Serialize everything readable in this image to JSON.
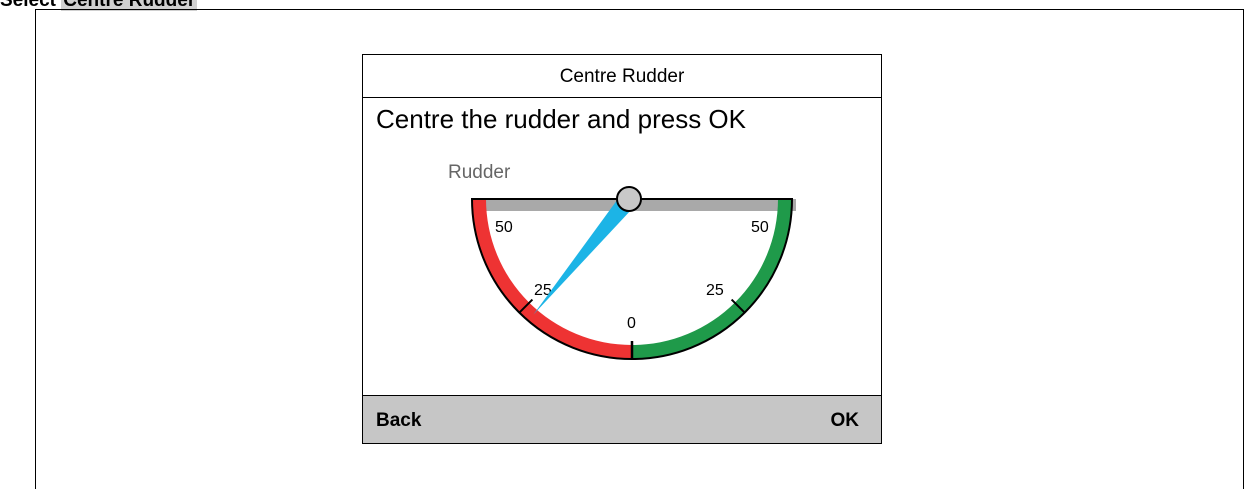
{
  "caption": {
    "prefix": "Select ",
    "highlight": "Centre Rudder"
  },
  "dialog": {
    "title": "Centre Rudder",
    "instruction": "Centre the rudder and press OK",
    "gauge": {
      "label": "Rudder",
      "tick_labels": {
        "port_50": "50",
        "port_25": "25",
        "zero": "0",
        "stbd_25": "25",
        "stbd_50": "50"
      },
      "rudder_angle": -22,
      "rudder_angle_note": "port side, degrees",
      "colors": {
        "port": "#ee3333",
        "starboard": "#1f9a4a",
        "needle": "#1cb4e6",
        "hub": "#c8c8c8",
        "bar": "#a9a9a9"
      }
    },
    "footer": {
      "back_label": "Back",
      "ok_label": "OK"
    }
  }
}
